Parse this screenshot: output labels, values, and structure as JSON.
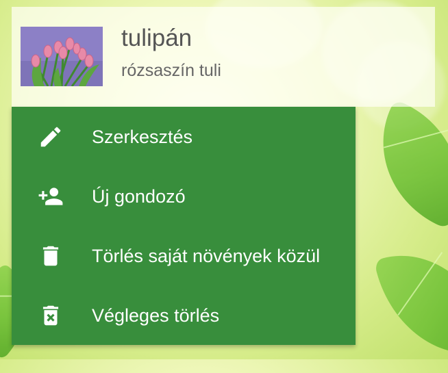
{
  "plant": {
    "name": "tulipán",
    "subtitle": "rózsaszín tuli",
    "image_icon": "tulip-photo"
  },
  "menu": {
    "background_color": "#388e3c",
    "items": [
      {
        "label": "Szerkesztés",
        "icon": "edit-icon"
      },
      {
        "label": "Új gondozó",
        "icon": "add-person-icon"
      },
      {
        "label": "Törlés saját növények közül",
        "icon": "trash-icon"
      },
      {
        "label": "Végleges törlés",
        "icon": "delete-forever-icon"
      }
    ]
  }
}
